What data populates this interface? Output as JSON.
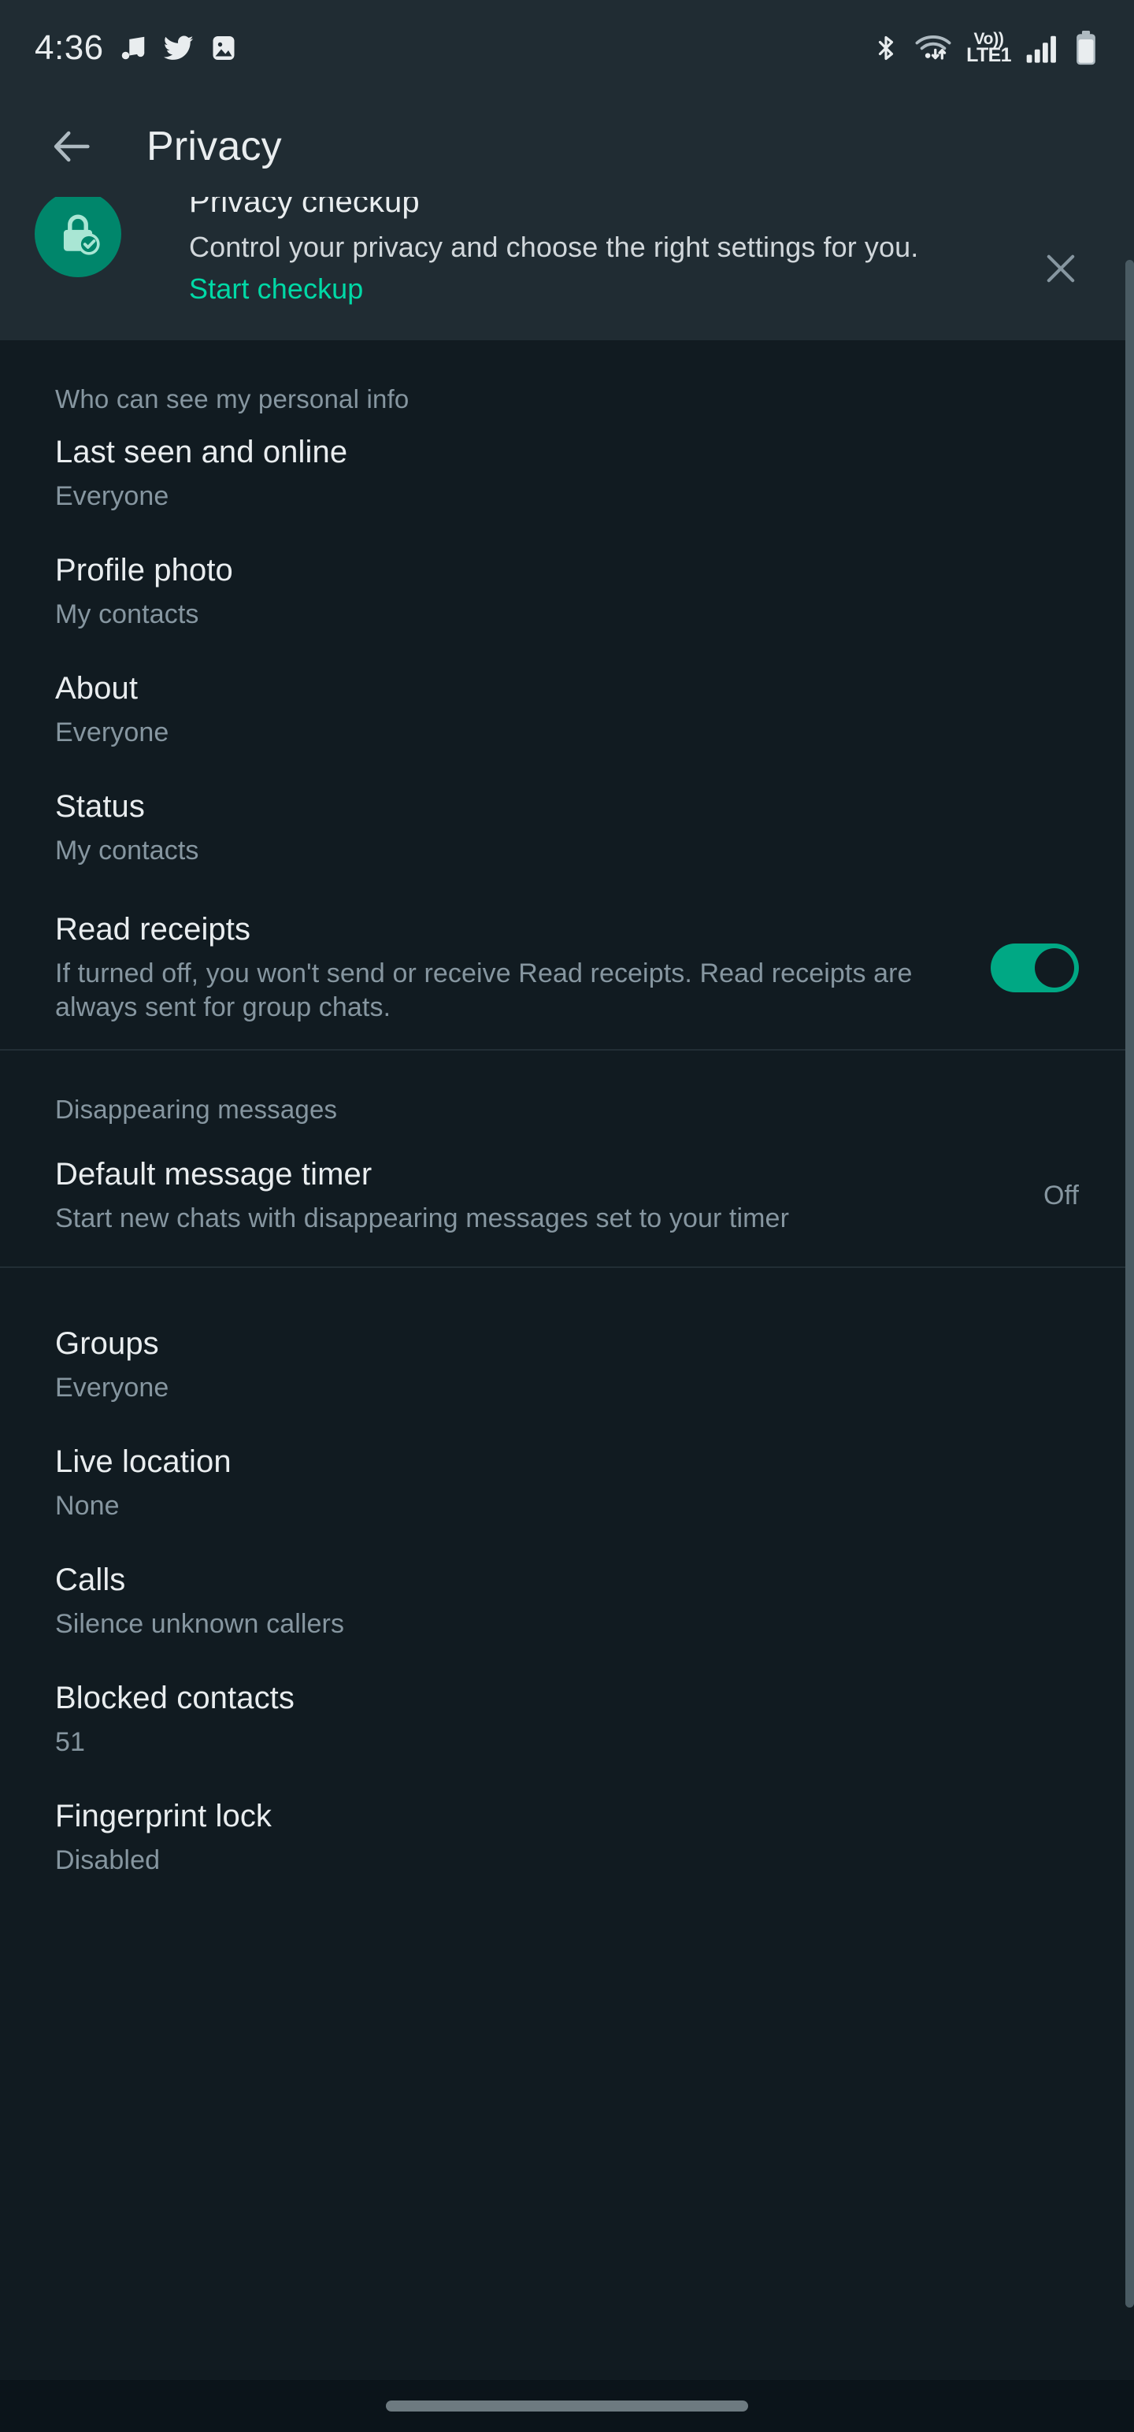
{
  "status_bar": {
    "time": "4:36",
    "left_icons": [
      "music-note-icon",
      "twitter-icon",
      "image-icon"
    ],
    "right_icons": [
      "bluetooth-icon",
      "wifi-icon",
      "volte-icon",
      "signal-bars-icon",
      "battery-icon"
    ],
    "volte_top": "Vo))",
    "volte_bottom": "LTE1"
  },
  "app_bar": {
    "back_icon": "back-arrow-icon",
    "title": "Privacy"
  },
  "banner": {
    "icon": "lock-check-icon",
    "title": "Privacy checkup",
    "description": "Control your privacy and choose the right settings for you.",
    "link": "Start checkup",
    "close_icon": "close-icon"
  },
  "sections": [
    {
      "header": "Who can see my personal info",
      "rows": [
        {
          "title": "Last seen and online",
          "subtitle": "Everyone"
        },
        {
          "title": "Profile photo",
          "subtitle": "My contacts"
        },
        {
          "title": "About",
          "subtitle": "Everyone"
        },
        {
          "title": "Status",
          "subtitle": "My contacts"
        },
        {
          "title": "Read receipts",
          "subtitle": "If turned off, you won't send or receive Read receipts. Read receipts are always sent for group chats.",
          "toggle": "on"
        }
      ]
    },
    {
      "header": "Disappearing messages",
      "rows": [
        {
          "title": "Default message timer",
          "subtitle": "Start new chats with disappearing messages set to your timer",
          "value": "Off"
        }
      ]
    },
    {
      "header": "",
      "rows": [
        {
          "title": "Groups",
          "subtitle": "Everyone"
        },
        {
          "title": "Live location",
          "subtitle": "None"
        },
        {
          "title": "Calls",
          "subtitle": "Silence unknown callers"
        },
        {
          "title": "Blocked contacts",
          "subtitle": "51"
        },
        {
          "title": "Fingerprint lock",
          "subtitle": "Disabled"
        }
      ]
    }
  ],
  "colors": {
    "accent_green": "#00a884",
    "link_green": "#00d9a6",
    "banner_bg": "#202c33",
    "page_bg": "#111b21",
    "primary_text": "#e9edef",
    "secondary_text": "#8696a0"
  },
  "nav_bar": {
    "pill": "home-gesture-pill"
  }
}
